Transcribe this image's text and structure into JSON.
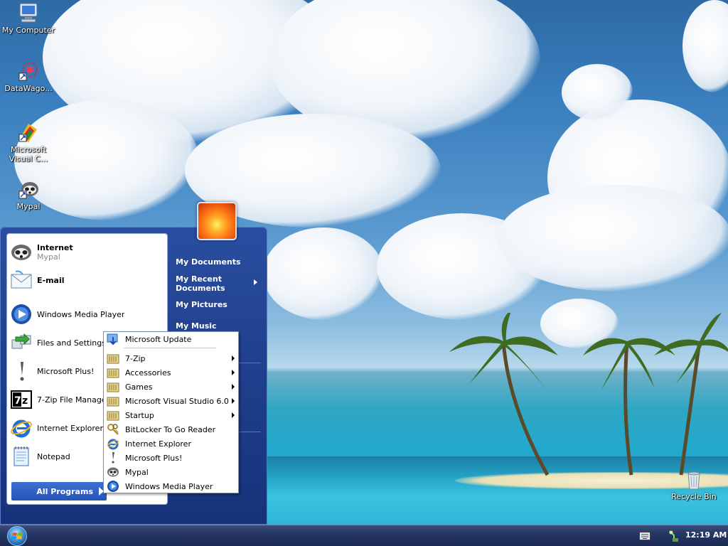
{
  "desktop": {
    "icons": [
      {
        "label": "My Computer",
        "icon": "computer-icon"
      },
      {
        "label": "DataWago...",
        "icon": "datawagon-icon"
      },
      {
        "label": "Microsoft Visual C...",
        "icon": "visual-c-icon"
      },
      {
        "label": "Mypal",
        "icon": "mypal-icon"
      },
      {
        "label": "Recycle Bin",
        "icon": "recycle-bin-icon"
      }
    ]
  },
  "start_menu": {
    "pinned": [
      {
        "title": "Internet",
        "subtitle": "Mypal",
        "icon": "mypal-icon"
      },
      {
        "title": "E-mail",
        "icon": "mail-icon"
      }
    ],
    "recent": [
      {
        "label": "Windows Media Player",
        "icon": "media-player-icon"
      },
      {
        "label": "Files and Settings",
        "icon": "transfer-icon"
      },
      {
        "label": "Microsoft Plus!",
        "icon": "plus-icon"
      },
      {
        "label": "7-Zip File Manage",
        "icon": "seven-zip-icon"
      },
      {
        "label": "Internet Explorer",
        "icon": "ie-icon"
      },
      {
        "label": "Notepad",
        "icon": "notepad-icon"
      }
    ],
    "all_programs_label": "All Programs",
    "right_links": [
      {
        "label": "My Documents"
      },
      {
        "label": "My Recent Documents"
      },
      {
        "label": "My Pictures"
      },
      {
        "label": "My Music"
      }
    ]
  },
  "all_programs_menu": {
    "items": [
      {
        "label": "Microsoft Update",
        "icon": "update-icon",
        "submenu": false
      },
      {
        "label": "7-Zip",
        "icon": "folder-icon",
        "submenu": true
      },
      {
        "label": "Accessories",
        "icon": "folder-icon",
        "submenu": true
      },
      {
        "label": "Games",
        "icon": "folder-icon",
        "submenu": true
      },
      {
        "label": "Microsoft Visual Studio 6.0",
        "icon": "folder-icon",
        "submenu": true
      },
      {
        "label": "Startup",
        "icon": "folder-icon",
        "submenu": true
      },
      {
        "label": "BitLocker To Go Reader",
        "icon": "bitlocker-icon",
        "submenu": false
      },
      {
        "label": "Internet Explorer",
        "icon": "ie-icon",
        "submenu": false
      },
      {
        "label": "Microsoft Plus!",
        "icon": "plus-icon",
        "submenu": false
      },
      {
        "label": "Mypal",
        "icon": "mypal-icon",
        "submenu": false
      },
      {
        "label": "Windows Media Player",
        "icon": "media-player-icon",
        "submenu": false
      }
    ]
  },
  "taskbar": {
    "clock": "12:19 AM"
  },
  "colors": {
    "start_menu_blue": "#1f3f8c",
    "all_programs_highlight": "#2555b8"
  }
}
